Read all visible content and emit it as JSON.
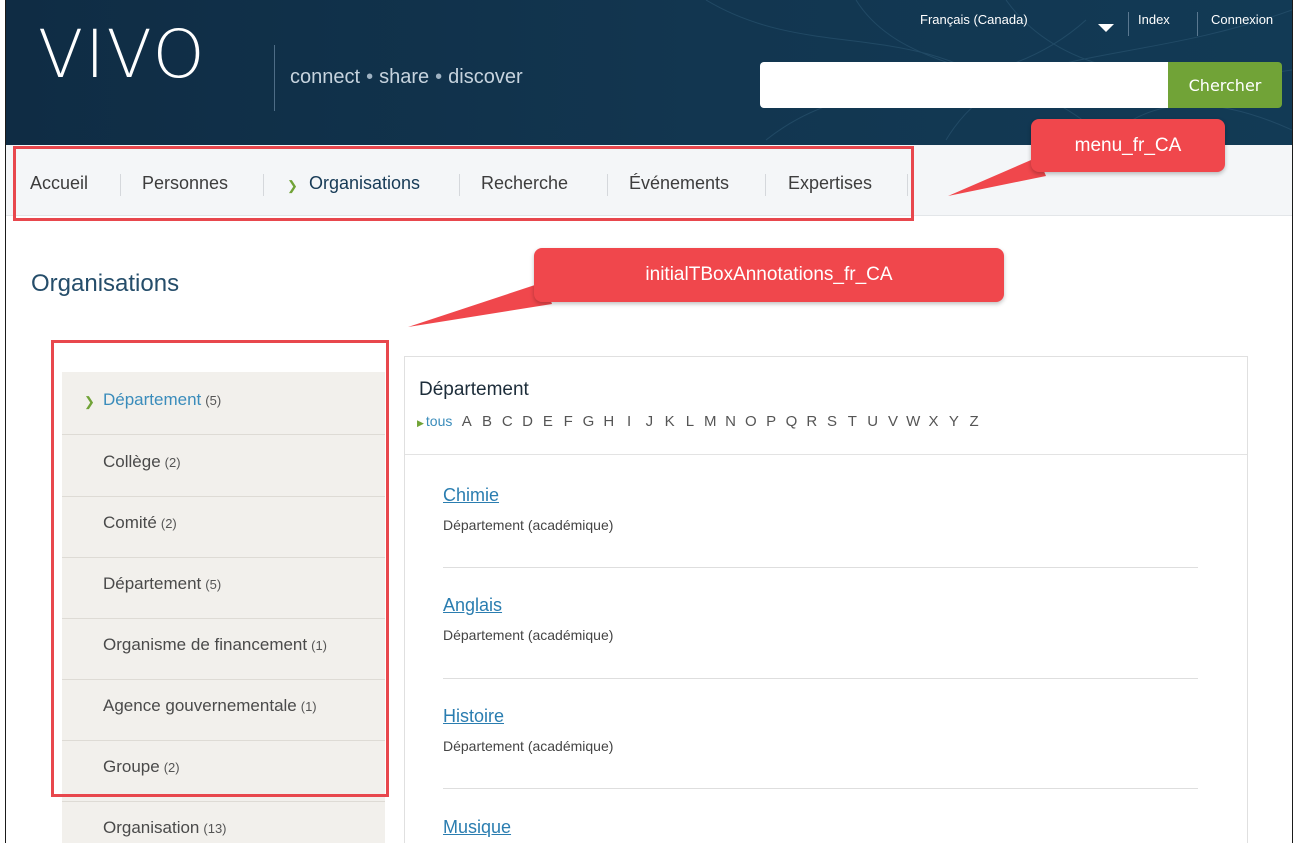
{
  "header": {
    "logo": "VIVO",
    "tagline": [
      "connect",
      "share",
      "discover"
    ],
    "tagline_dot": "•",
    "language": "Français (Canada)",
    "index_link": "Index",
    "login_link": "Connexion",
    "search_placeholder": "",
    "search_button": "Chercher"
  },
  "nav": {
    "items": [
      "Accueil",
      "Personnes",
      "Organisations",
      "Recherche",
      "Événements",
      "Expertises"
    ],
    "active": "Organisations"
  },
  "page": {
    "title": "Organisations"
  },
  "sidebar": {
    "items": [
      {
        "label": "Département",
        "count": "(5)",
        "active": true
      },
      {
        "label": "Collège",
        "count": "(2)"
      },
      {
        "label": "Comité",
        "count": "(2)"
      },
      {
        "label": "Département",
        "count": "(5)"
      },
      {
        "label": "Organisme de financement",
        "count": "(1)"
      },
      {
        "label": "Agence gouvernementale",
        "count": "(1)"
      },
      {
        "label": "Groupe",
        "count": "(2)"
      },
      {
        "label": "Organisation",
        "count": "(13)"
      }
    ]
  },
  "panel": {
    "title": "Département",
    "all_label": "tous",
    "letters": [
      "A",
      "B",
      "C",
      "D",
      "E",
      "F",
      "G",
      "H",
      "I",
      "J",
      "K",
      "L",
      "M",
      "N",
      "O",
      "P",
      "Q",
      "R",
      "S",
      "T",
      "U",
      "V",
      "W",
      "X",
      "Y",
      "Z"
    ],
    "orgs": [
      {
        "name": "Chimie",
        "type": "Département (académique)"
      },
      {
        "name": "Anglais",
        "type": "Département (académique)"
      },
      {
        "name": "Histoire",
        "type": "Département (académique)"
      },
      {
        "name": "Musique",
        "type": ""
      }
    ]
  },
  "annotations": {
    "menu_label": "menu_fr_CA",
    "tbox_label": "initialTBoxAnnotations_fr_CA",
    "color": "#e8474d"
  },
  "colors": {
    "header_bg": "#123650",
    "accent_green": "#71a337",
    "link_blue": "#2a7db0"
  }
}
